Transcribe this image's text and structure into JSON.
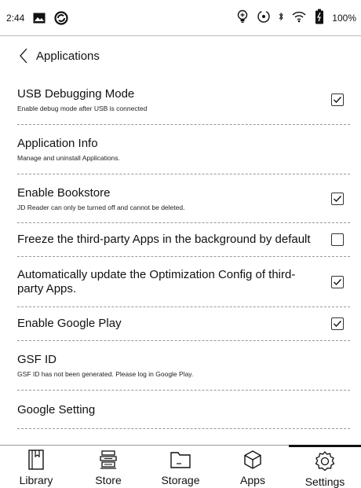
{
  "status_bar": {
    "time": "2:44",
    "battery_text": "100%",
    "icons": [
      "image-icon",
      "sync-status-icon",
      "bulb-icon",
      "refresh-icon",
      "bluetooth-icon",
      "wifi-icon",
      "battery-icon"
    ]
  },
  "header": {
    "title": "Applications"
  },
  "settings": [
    {
      "title": "USB Debugging Mode",
      "subtitle": "Enable debug mode after USB is connected",
      "checkbox": true,
      "checked": true
    },
    {
      "title": "Application Info",
      "subtitle": "Manage and uninstall Applications.",
      "checkbox": false
    },
    {
      "title": "Enable Bookstore",
      "subtitle": "JD Reader can only be turned off and cannot be deleted.",
      "checkbox": true,
      "checked": true
    },
    {
      "title": "Freeze the third-party Apps in the background by default",
      "subtitle": "",
      "checkbox": true,
      "checked": false
    },
    {
      "title": "Automatically update the Optimization Config of third-party Apps.",
      "subtitle": "",
      "checkbox": true,
      "checked": true
    },
    {
      "title": "Enable Google Play",
      "subtitle": "",
      "checkbox": true,
      "checked": true
    },
    {
      "title": "GSF ID",
      "subtitle": "GSF ID has not been generated. Please log in Google Play.",
      "checkbox": false
    },
    {
      "title": "Google Setting",
      "subtitle": "",
      "checkbox": false
    }
  ],
  "nav": {
    "items": [
      {
        "label": "Library",
        "icon": "library-icon"
      },
      {
        "label": "Store",
        "icon": "store-icon"
      },
      {
        "label": "Storage",
        "icon": "folder-icon"
      },
      {
        "label": "Apps",
        "icon": "apps-cube-icon"
      },
      {
        "label": "Settings",
        "icon": "settings-gear-icon"
      }
    ],
    "active": "Settings"
  }
}
